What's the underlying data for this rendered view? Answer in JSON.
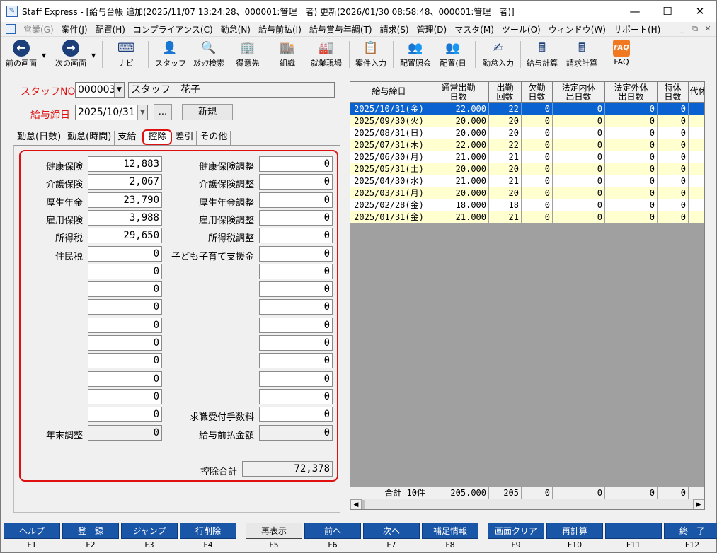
{
  "window": {
    "title": "Staff Express - [給与台帳 追加(2025/11/07 13:24:28、000001:管理　者) 更新(2026/01/30 08:58:48、000001:管理　者)]"
  },
  "menu": [
    "営業(G)",
    "案件(J)",
    "配置(H)",
    "コンプライアンス(C)",
    "勤怠(N)",
    "給与前払(I)",
    "給与賞与年調(T)",
    "請求(S)",
    "管理(D)",
    "マスタ(M)",
    "ツール(O)",
    "ウィンドウ(W)",
    "サポート(H)"
  ],
  "toolbar": {
    "prev": "前の画面",
    "next": "次の画面",
    "navi": "ナビ",
    "staff": "スタッフ",
    "staff_search": "ｽﾀｯﾌ検索",
    "client": "得意先",
    "org": "組織",
    "site": "就業現場",
    "case_input": "案件入力",
    "assign_ref": "配置照会",
    "assign_day": "配置(日",
    "attendance_input": "勤怠入力",
    "payroll_calc": "給与計算",
    "billing_calc": "請求計算",
    "faq": "FAQ",
    "faq_glyph": "FAQ"
  },
  "form": {
    "staff_no_label": "スタッフNO",
    "staff_no": "000003",
    "staff_name": "スタッフ　花子",
    "pay_close_label": "給与締日",
    "pay_close_date": "2025/10/31",
    "ellipsis": "...",
    "new_button": "新規"
  },
  "tabs": [
    "勤怠(日数)",
    "勤怠(時間)",
    "支給",
    "控除",
    "差引",
    "その他"
  ],
  "deductions": {
    "left": [
      {
        "label": "健康保険",
        "value": "12,883"
      },
      {
        "label": "介護保険",
        "value": "2,067"
      },
      {
        "label": "厚生年金",
        "value": "23,790"
      },
      {
        "label": "雇用保険",
        "value": "3,988"
      },
      {
        "label": "所得税",
        "value": "29,650"
      },
      {
        "label": "住民税",
        "value": "0"
      },
      {
        "label": "",
        "value": "0"
      },
      {
        "label": "",
        "value": "0"
      },
      {
        "label": "",
        "value": "0"
      },
      {
        "label": "",
        "value": "0"
      },
      {
        "label": "",
        "value": "0"
      },
      {
        "label": "",
        "value": "0"
      },
      {
        "label": "",
        "value": "0"
      },
      {
        "label": "",
        "value": "0"
      },
      {
        "label": "",
        "value": "0"
      },
      {
        "label": "年末調整",
        "value": "0"
      }
    ],
    "right": [
      {
        "label": "健康保険調整",
        "value": "0"
      },
      {
        "label": "介護保険調整",
        "value": "0"
      },
      {
        "label": "厚生年金調整",
        "value": "0"
      },
      {
        "label": "雇用保険調整",
        "value": "0"
      },
      {
        "label": "所得税調整",
        "value": "0"
      },
      {
        "label": "子ども子育て支援金",
        "value": "0"
      },
      {
        "label": "",
        "value": "0"
      },
      {
        "label": "",
        "value": "0"
      },
      {
        "label": "",
        "value": "0"
      },
      {
        "label": "",
        "value": "0"
      },
      {
        "label": "",
        "value": "0"
      },
      {
        "label": "",
        "value": "0"
      },
      {
        "label": "",
        "value": "0"
      },
      {
        "label": "",
        "value": "0"
      },
      {
        "label": "求職受付手数料",
        "value": "0"
      },
      {
        "label": "給与前払金額",
        "value": "0"
      }
    ],
    "total_label": "控除合計",
    "total": "72,378"
  },
  "grid": {
    "headers": [
      "給与締日",
      "通常出勤日数",
      "出勤回数",
      "欠勤日数",
      "法定内休出日数",
      "法定外休出日数",
      "特休日数",
      "代休日"
    ],
    "header_lines": [
      [
        "給与締日",
        ""
      ],
      [
        "通常出勤",
        "日数"
      ],
      [
        "出勤",
        "回数"
      ],
      [
        "欠勤",
        "日数"
      ],
      [
        "法定内休",
        "出日数"
      ],
      [
        "法定外休",
        "出日数"
      ],
      [
        "特休",
        "日数"
      ],
      [
        "代休日",
        ""
      ]
    ],
    "rows": [
      [
        "2025/10/31(金)",
        "22.000",
        "22",
        "0",
        "0",
        "0",
        "0",
        "0"
      ],
      [
        "2025/09/30(火)",
        "20.000",
        "20",
        "0",
        "0",
        "0",
        "0",
        "0"
      ],
      [
        "2025/08/31(日)",
        "20.000",
        "20",
        "0",
        "0",
        "0",
        "0",
        "0"
      ],
      [
        "2025/07/31(木)",
        "22.000",
        "22",
        "0",
        "0",
        "0",
        "0",
        "0"
      ],
      [
        "2025/06/30(月)",
        "21.000",
        "21",
        "0",
        "0",
        "0",
        "0",
        "0"
      ],
      [
        "2025/05/31(土)",
        "20.000",
        "20",
        "0",
        "0",
        "0",
        "0",
        "0"
      ],
      [
        "2025/04/30(水)",
        "21.000",
        "21",
        "0",
        "0",
        "0",
        "0",
        "0"
      ],
      [
        "2025/03/31(月)",
        "20.000",
        "20",
        "0",
        "0",
        "0",
        "0",
        "0"
      ],
      [
        "2025/02/28(金)",
        "18.000",
        "18",
        "0",
        "0",
        "0",
        "0",
        "0"
      ],
      [
        "2025/01/31(金)",
        "21.000",
        "21",
        "0",
        "0",
        "0",
        "0",
        "0"
      ]
    ],
    "footer": [
      "合計 10件",
      "205.000",
      "205",
      "0",
      "0",
      "0",
      "0",
      "0"
    ]
  },
  "fkeys": [
    {
      "label": "ヘルプ",
      "key": "F1"
    },
    {
      "label": "登　録",
      "key": "F2"
    },
    {
      "label": "ジャンプ",
      "key": "F3"
    },
    {
      "label": "行削除",
      "key": "F4"
    },
    {
      "label": "再表示",
      "key": "F5"
    },
    {
      "label": "前へ",
      "key": "F6"
    },
    {
      "label": "次へ",
      "key": "F7"
    },
    {
      "label": "補足情報",
      "key": "F8"
    },
    {
      "label": "画面クリア",
      "key": "F9"
    },
    {
      "label": "再計算",
      "key": "F10"
    },
    {
      "label": "",
      "key": "F11"
    },
    {
      "label": "終　了",
      "key": "F12"
    }
  ],
  "colors": {
    "selected_row": "#0a62d0",
    "highlight_red": "#e01010",
    "fkey_blue": "#1a56a8",
    "alt_row": "#ffffd0"
  }
}
